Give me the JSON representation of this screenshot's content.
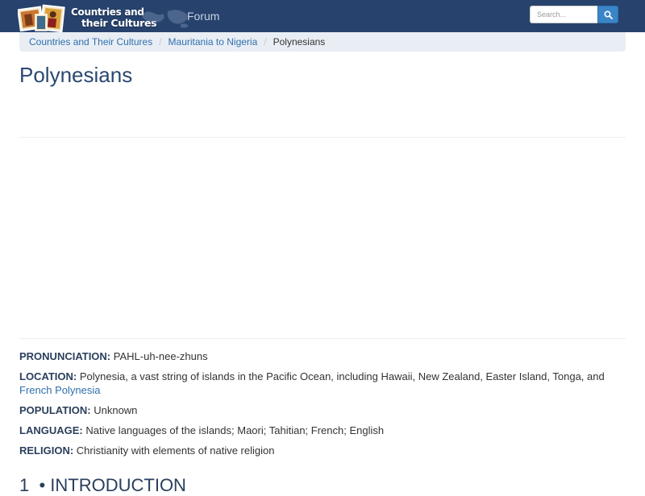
{
  "header": {
    "logo": {
      "line1": "Countries and",
      "line2": "their Cultures"
    },
    "nav": {
      "forum_label": "Forum"
    },
    "search": {
      "placeholder": "Search..."
    }
  },
  "breadcrumb": [
    {
      "label": "Countries and Their Cultures"
    },
    {
      "label": "Mauritania to Nigeria"
    },
    {
      "label": "Polynesians"
    }
  ],
  "page": {
    "title": "Polynesians"
  },
  "facts": {
    "pronunciation": {
      "label": "PRONUNCIATION:",
      "value": "PAHL-uh-nee-zhuns"
    },
    "location": {
      "label": "LOCATION:",
      "value": "Polynesia, a vast string of islands in the Pacific Ocean, including Hawaii, New Zealand, Easter Island, Tonga, and",
      "link": "French Polynesia"
    },
    "population": {
      "label": "POPULATION:",
      "value": "Unknown"
    },
    "language": {
      "label": "LANGUAGE:",
      "value": "Native languages of the islands; Maori; Tahitian; French; English"
    },
    "religion": {
      "label": "RELIGION:",
      "value": "Christianity with elements of native religion"
    }
  },
  "section": {
    "number": "1",
    "title": "INTRODUCTION"
  },
  "colors": {
    "navbar": "#27426c",
    "link": "#2f6fae",
    "title": "#2a4870",
    "breadcrumb_bg": "#e9eef4",
    "search_button": "#3a85c8"
  }
}
